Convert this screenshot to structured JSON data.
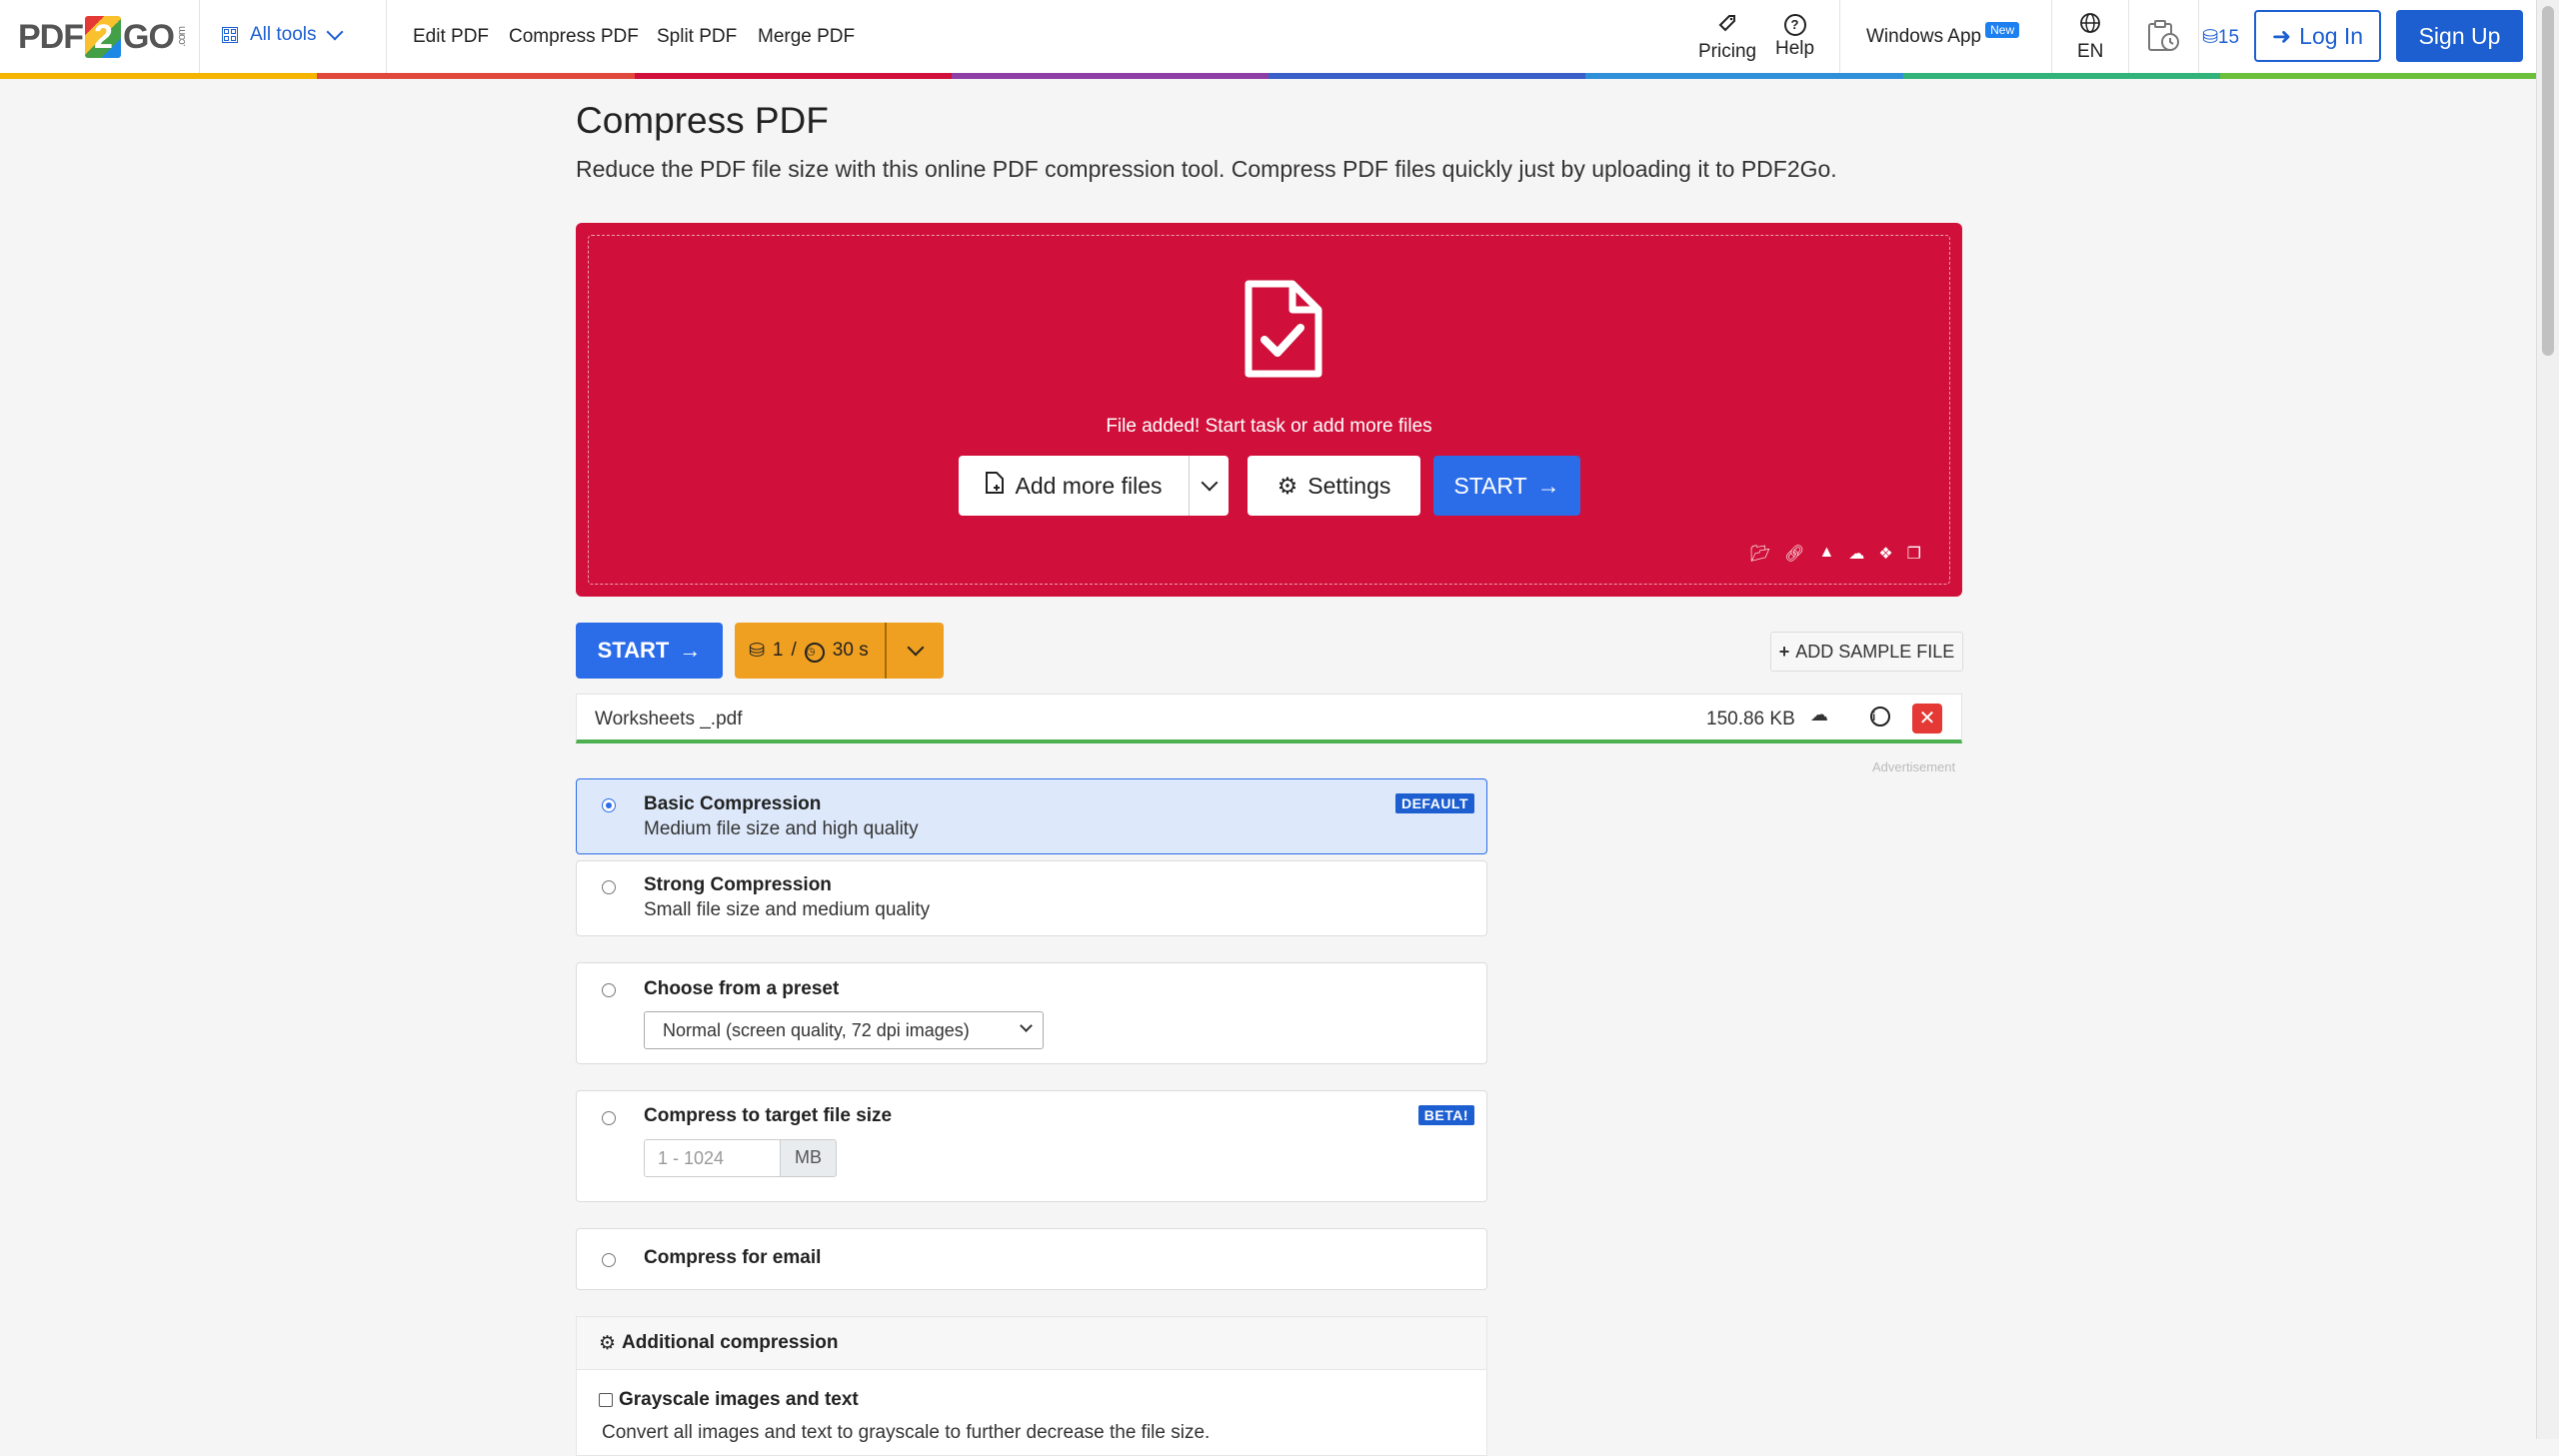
{
  "nav": {
    "logo_pre": "PDF",
    "logo_two": "2",
    "logo_post": "GO",
    "logo_suffix": ".com",
    "all_tools": "All tools",
    "links": [
      "Edit PDF",
      "Compress PDF",
      "Split PDF",
      "Merge PDF"
    ],
    "pricing": "Pricing",
    "help": "Help",
    "windows_app": "Windows App",
    "new_badge": "New",
    "language": "EN",
    "credits": "15",
    "login": "Log In",
    "signup": "Sign Up"
  },
  "rainbow_colors": [
    "#f4b400",
    "#e0483c",
    "#d0103a",
    "#8e3fa6",
    "#3a5fc8",
    "#2f8fd8",
    "#31b37a",
    "#6cbf3a"
  ],
  "page": {
    "title": "Compress PDF",
    "subtitle": "Reduce the PDF file size with this online PDF compression tool. Compress PDF files quickly just by uploading it to PDF2Go."
  },
  "dropzone": {
    "message": "File added! Start task or add more files",
    "add_more": "Add more files",
    "settings": "Settings",
    "start": "START",
    "source_icons": [
      "folder-icon",
      "link-icon",
      "google-drive-icon",
      "onedrive-icon",
      "dropbox-icon",
      "clipboard-icon"
    ],
    "color": "#d0103a"
  },
  "toolbar": {
    "start": "START",
    "credit_count": "1",
    "separator": "/",
    "time": "30 s",
    "add_sample": "ADD SAMPLE FILE"
  },
  "file": {
    "name": "Worksheets _.pdf",
    "size": "150.86 KB"
  },
  "advertisement": "Advertisement",
  "options": [
    {
      "title": "Basic Compression",
      "desc": "Medium file size and high quality",
      "tag": "DEFAULT",
      "selected": true
    },
    {
      "title": "Strong Compression",
      "desc": "Small file size and medium quality",
      "selected": false
    },
    {
      "title": "Choose from a preset",
      "preset_value": "Normal (screen quality, 72 dpi images)",
      "selected": false
    },
    {
      "title": "Compress to target file size",
      "tag": "BETA!",
      "placeholder": "1 - 1024",
      "unit": "MB",
      "selected": false
    },
    {
      "title": "Compress for email",
      "selected": false
    }
  ],
  "additional": {
    "heading": "Additional compression",
    "grayscale_label": "Grayscale images and text",
    "grayscale_desc": "Convert all images and text to grayscale to further decrease the file size."
  }
}
